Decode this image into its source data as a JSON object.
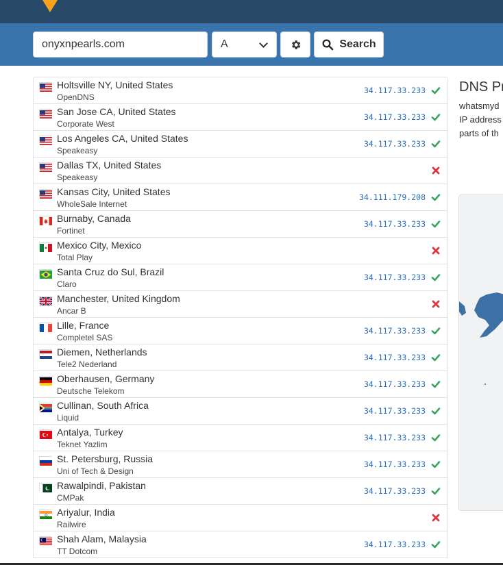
{
  "search": {
    "domain": "onyxnpearls.com",
    "record_type": "A",
    "button_label": "Search"
  },
  "icons": {
    "settings": "gear-icon",
    "search": "magnifier-icon",
    "ok": "checkmark-icon",
    "fail": "cross-icon"
  },
  "colors": {
    "topbar": "#284868",
    "searchbar": "#3a74ad",
    "logo": "#f7a21b",
    "ok": "#3aa35a",
    "fail": "#d9363e",
    "ip": "#2a6fb6"
  },
  "results": [
    {
      "location": "Holtsville NY, United States",
      "isp": "OpenDNS",
      "ip": "34.117.33.233",
      "ok": true,
      "flag": "us"
    },
    {
      "location": "San Jose CA, United States",
      "isp": "Corporate West",
      "ip": "34.117.33.233",
      "ok": true,
      "flag": "us"
    },
    {
      "location": "Los Angeles CA, United States",
      "isp": "Speakeasy",
      "ip": "34.117.33.233",
      "ok": true,
      "flag": "us"
    },
    {
      "location": "Dallas TX, United States",
      "isp": "Speakeasy",
      "ip": "",
      "ok": false,
      "flag": "us"
    },
    {
      "location": "Kansas City, United States",
      "isp": "WholeSale Internet",
      "ip": "34.111.179.208",
      "ok": true,
      "flag": "us"
    },
    {
      "location": "Burnaby, Canada",
      "isp": "Fortinet",
      "ip": "34.117.33.233",
      "ok": true,
      "flag": "ca"
    },
    {
      "location": "Mexico City, Mexico",
      "isp": "Total Play",
      "ip": "",
      "ok": false,
      "flag": "mx"
    },
    {
      "location": "Santa Cruz do Sul, Brazil",
      "isp": "Claro",
      "ip": "34.117.33.233",
      "ok": true,
      "flag": "br"
    },
    {
      "location": "Manchester, United Kingdom",
      "isp": "Ancar B",
      "ip": "",
      "ok": false,
      "flag": "gb"
    },
    {
      "location": "Lille, France",
      "isp": "Completel SAS",
      "ip": "34.117.33.233",
      "ok": true,
      "flag": "fr"
    },
    {
      "location": "Diemen, Netherlands",
      "isp": "Tele2 Nederland",
      "ip": "34.117.33.233",
      "ok": true,
      "flag": "nl"
    },
    {
      "location": "Oberhausen, Germany",
      "isp": "Deutsche Telekom",
      "ip": "34.117.33.233",
      "ok": true,
      "flag": "de"
    },
    {
      "location": "Cullinan, South Africa",
      "isp": "Liquid",
      "ip": "34.117.33.233",
      "ok": true,
      "flag": "za"
    },
    {
      "location": "Antalya, Turkey",
      "isp": "Teknet Yazlim",
      "ip": "34.117.33.233",
      "ok": true,
      "flag": "tr"
    },
    {
      "location": "St. Petersburg, Russia",
      "isp": "Uni of Tech & Design",
      "ip": "34.117.33.233",
      "ok": true,
      "flag": "ru"
    },
    {
      "location": "Rawalpindi, Pakistan",
      "isp": "CMPak",
      "ip": "34.117.33.233",
      "ok": true,
      "flag": "pk"
    },
    {
      "location": "Ariyalur, India",
      "isp": "Railwire",
      "ip": "",
      "ok": false,
      "flag": "in"
    },
    {
      "location": "Shah Alam, Malaysia",
      "isp": "TT Dotcom",
      "ip": "34.117.33.233",
      "ok": true,
      "flag": "my"
    }
  ],
  "sidebar": {
    "title": "DNS Pr",
    "lines": [
      "whatsmyd",
      "IP address",
      "parts of th"
    ]
  }
}
